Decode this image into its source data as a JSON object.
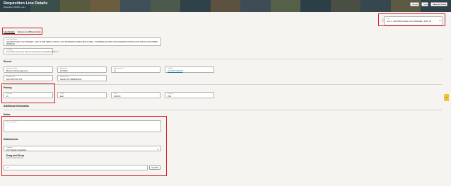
{
  "header": {
    "title": "Requisition Line Details",
    "subtitle": "Requisition: 000456, Line 1",
    "band_colors": [
      "#2c3e46",
      "#3b4f4a",
      "#5a5a3e",
      "#6b5d40",
      "#3f4f57",
      "#4b5a4c",
      "#2f4149",
      "#5d5240",
      "#3d4c55",
      "#556049",
      "#2c3e46",
      "#4a4f43",
      "#36474f",
      "#5c5a45",
      "#2e4048"
    ],
    "buttons": {
      "cancel": "Cancel",
      "save": "Save",
      "save_and_close": "Save and Close"
    }
  },
  "line_selector": {
    "label": "Line",
    "value": "Line 1 - LECTRON LEVEL 2 EV CHARGER - 120V, 16 ..."
  },
  "tabs": [
    {
      "label": "Line Details",
      "active": true
    },
    {
      "label": "Delivery and Billing Details",
      "active": false
    }
  ],
  "item": {
    "description_label": "Item Description",
    "description_value": "LECTRON LEVEL 2 EV CHARGER - 240V, 32 AMP, NEMA 6-30 PLUG, 21FT EXTENSION CORD & TESLA CABLE - PORTABLE ELECTRIC CAR CHARGER FOR TESLA EVS AND PLUG-IN HYBRID VEHICLES",
    "category_label": "Category",
    "category_value": "ELECTRICAL ELECTRICAL SUPPLIES WORKS EQ NO EQUIPMENT WORKS / 4"
  },
  "source": {
    "title": "Source",
    "fields": [
      {
        "label": "Agreement Type",
        "value": "Blanket Purchase Agreement",
        "link": false
      },
      {
        "label": "Agreement",
        "value": "AGTH412",
        "link": false
      },
      {
        "label": "Agreement Line",
        "value": "10",
        "link": false
      },
      {
        "label": "Supplier",
        "value": "LECTRON LIMITED",
        "link": true
      },
      {
        "label": "Supplier Site",
        "value": "LECTRON PTE. LTD",
        "link": false
      },
      {
        "label": "Supplier Item",
        "value": "LEC24V 32 / 40AMP BLACK",
        "link": false
      }
    ]
  },
  "pricing": {
    "title": "Pricing",
    "fields": [
      {
        "label": "Quantity",
        "value": "10"
      },
      {
        "label": "UOM",
        "value": "Each"
      },
      {
        "label": "Price",
        "value": "$ 448.00"
      },
      {
        "label": "Currency",
        "value": "USD"
      }
    ]
  },
  "additional_info": {
    "title": "Additional Information"
  },
  "notes": {
    "title": "Notes",
    "note_to_supplier_label": "Note to supplier"
  },
  "attachments": {
    "title": "Attachments",
    "category_label": "Category",
    "category_value": "From Supplier: Requisition",
    "drag_title": "Drag and Drop",
    "drag_sub": "Select or drop files here.",
    "url_label": "URL",
    "add_url": "Add URL"
  },
  "help_icon": "help-icon"
}
